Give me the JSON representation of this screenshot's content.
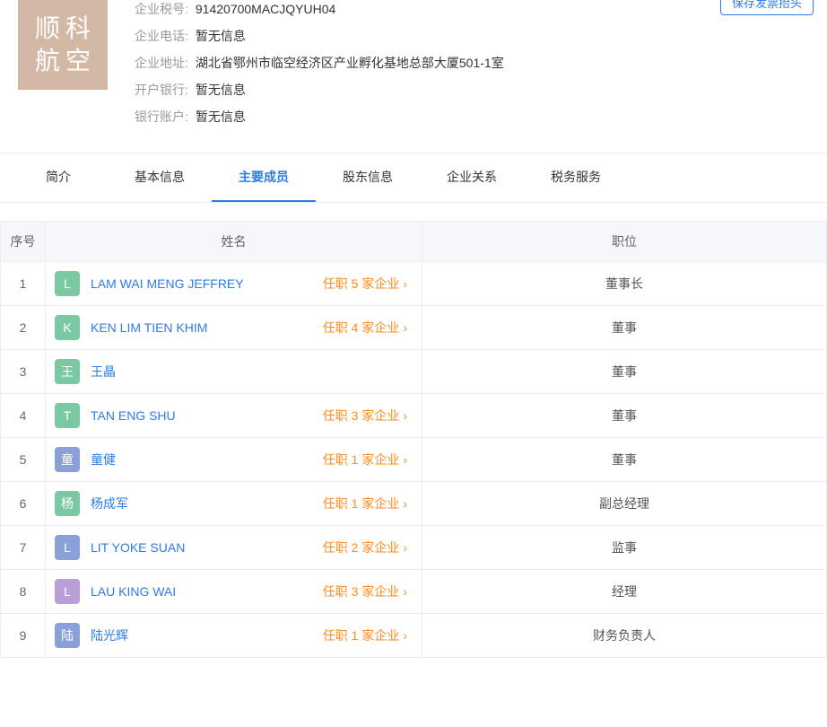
{
  "logo": {
    "line1": "顺科",
    "line2": "航空"
  },
  "topButton": {
    "label": "保存发票抬头"
  },
  "info": {
    "taxLabel": "企业税号:",
    "taxValue": "91420700MACJQYUH04",
    "phoneLabel": "企业电话:",
    "phoneValue": "暂无信息",
    "addrLabel": "企业地址:",
    "addrValue": "湖北省鄂州市临空经济区产业孵化基地总部大厦501-1室",
    "bankLabel": "开户银行:",
    "bankValue": "暂无信息",
    "acctLabel": "银行账户:",
    "acctValue": "暂无信息"
  },
  "tabs": {
    "t0": "简介",
    "t1": "基本信息",
    "t2": "主要成员",
    "t3": "股东信息",
    "t4": "企业关系",
    "t5": "税务服务"
  },
  "table": {
    "hIdx": "序号",
    "hName": "姓名",
    "hPos": "职位"
  },
  "rows": [
    {
      "idx": "1",
      "initial": "L",
      "color": "#7ac9a3",
      "name": "LAM WAI MENG JEFFREY",
      "job": "任职 5 家企业",
      "pos": "董事长"
    },
    {
      "idx": "2",
      "initial": "K",
      "color": "#7ac9a3",
      "name": "KEN LIM TIEN KHIM",
      "job": "任职 4 家企业",
      "pos": "董事"
    },
    {
      "idx": "3",
      "initial": "王",
      "color": "#7ac9a3",
      "name": "王晶",
      "job": "",
      "pos": "董事"
    },
    {
      "idx": "4",
      "initial": "T",
      "color": "#7ac9a3",
      "name": "TAN ENG SHU",
      "job": "任职 3 家企业",
      "pos": "董事"
    },
    {
      "idx": "5",
      "initial": "童",
      "color": "#8b9fd9",
      "name": "童健",
      "job": "任职 1 家企业",
      "pos": "董事"
    },
    {
      "idx": "6",
      "initial": "杨",
      "color": "#7ac9a3",
      "name": "杨成军",
      "job": "任职 1 家企业",
      "pos": "副总经理"
    },
    {
      "idx": "7",
      "initial": "L",
      "color": "#8b9fd9",
      "name": "LIT YOKE SUAN",
      "job": "任职 2 家企业",
      "pos": "监事"
    },
    {
      "idx": "8",
      "initial": "L",
      "color": "#b89fd9",
      "name": "LAU KING WAI",
      "job": "任职 3 家企业",
      "pos": "经理"
    },
    {
      "idx": "9",
      "initial": "陆",
      "color": "#8b9fd9",
      "name": "陆光辉",
      "job": "任职 1 家企业",
      "pos": "财务负责人"
    }
  ],
  "chevron": "›"
}
